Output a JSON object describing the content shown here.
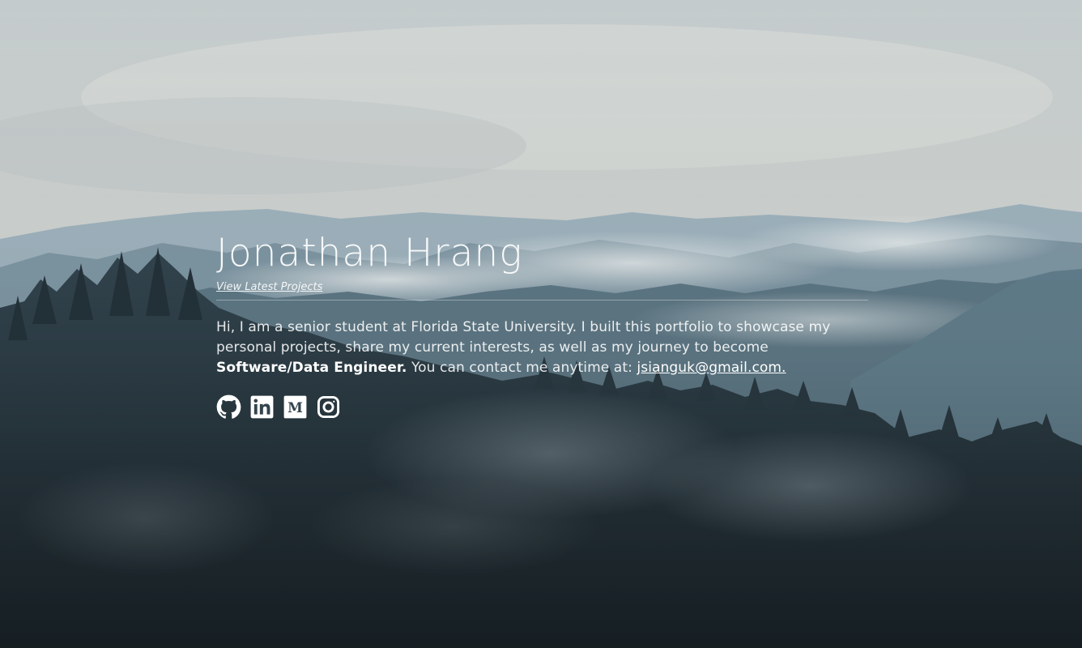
{
  "hero": {
    "name": "Jonathan Hrang",
    "projects_link": "View Latest Projects"
  },
  "bio": {
    "intro": "Hi, I am a senior student at Florida State University. I built this portfolio to showcase my personal projects, share my current interests, as well as my journey to become ",
    "role": "Software/Data Engineer.",
    "contact_prefix": " You can contact me anytime at: ",
    "email": "jsianguk@gmail.com."
  },
  "socials": [
    {
      "icon": "github-icon"
    },
    {
      "icon": "linkedin-icon"
    },
    {
      "icon": "medium-icon"
    },
    {
      "icon": "instagram-icon"
    }
  ],
  "colors": {
    "sky_top": "#c9cfcf",
    "mountains_far": "#8fa6b3",
    "mountains_mid": "#5d7a8a",
    "forest_dark": "#22313a",
    "text": "#ffffff"
  }
}
